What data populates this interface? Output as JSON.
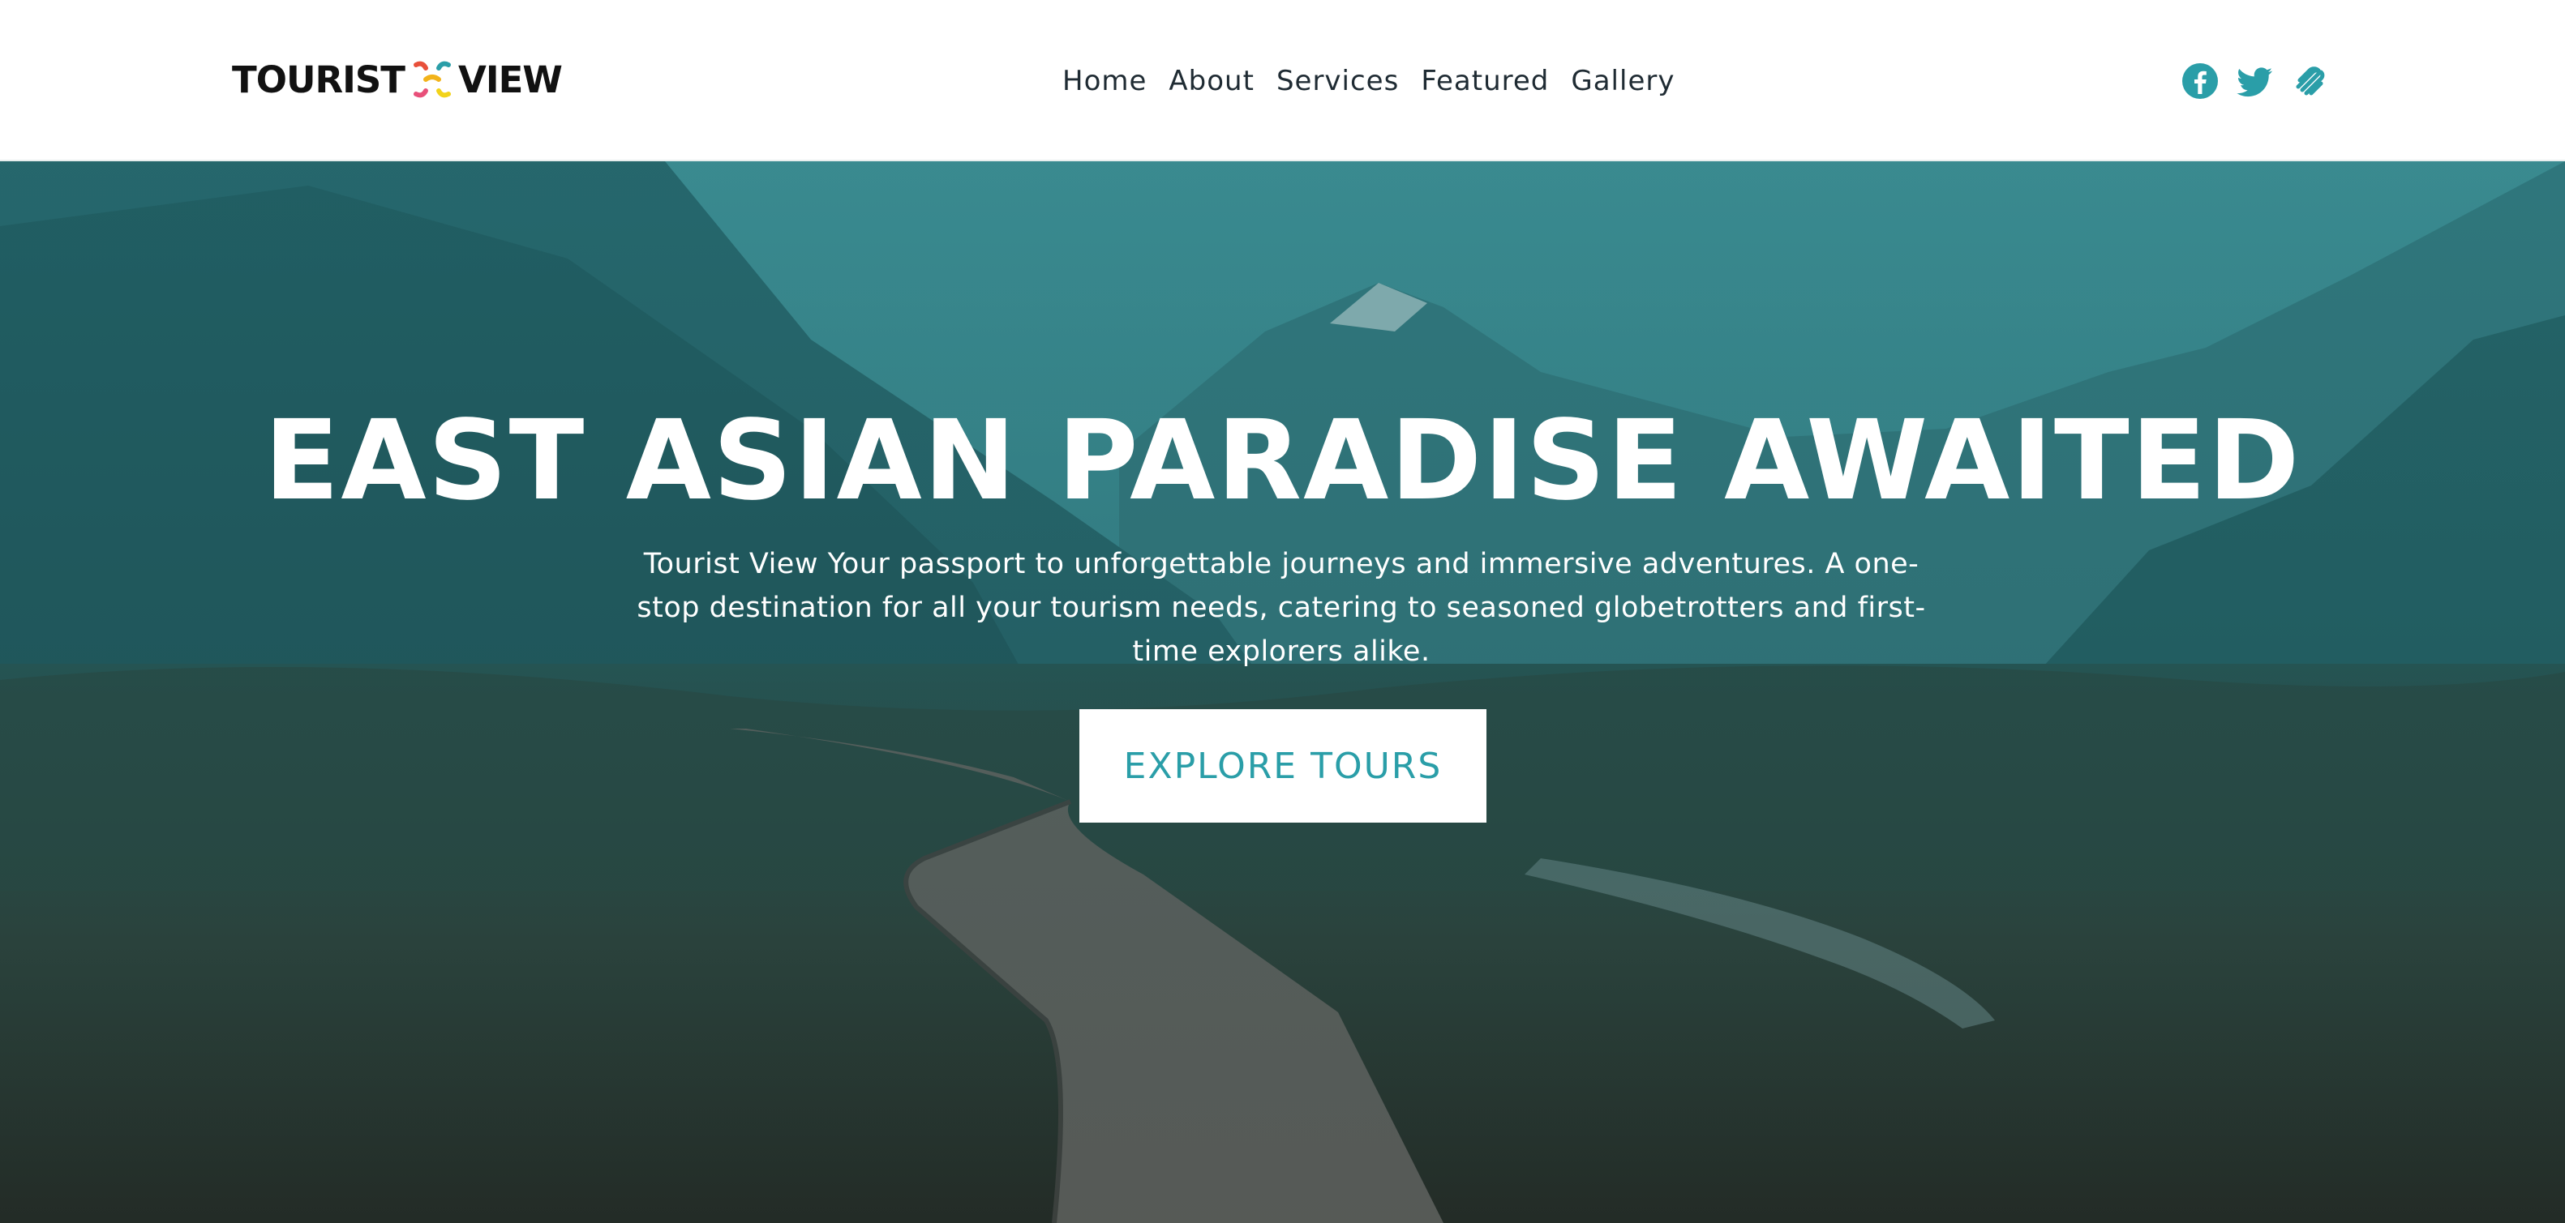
{
  "header": {
    "logo": {
      "part1": "TOURIST",
      "part2": "VIEW"
    },
    "nav": [
      "Home",
      "About",
      "Services",
      "Featured",
      "Gallery"
    ],
    "social": [
      "facebook-icon",
      "twitter-icon",
      "squarespace-icon"
    ]
  },
  "hero": {
    "title": "EAST ASIAN PARADISE AWAITED",
    "text": "Tourist View Your passport to unforgettable journeys and immersive adventures. A one-stop destination for all your tourism needs, catering to seasoned globetrotters and first-time explorers alike.",
    "button": "EXPLORE TOURS"
  },
  "colors": {
    "accent": "#2a9ea8",
    "text_dark": "#111111",
    "overlay": "#1d6e74"
  }
}
